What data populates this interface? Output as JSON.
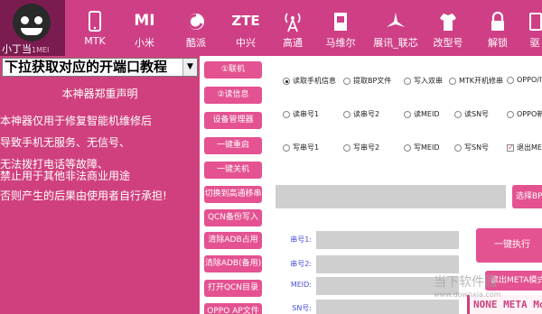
{
  "logo": {
    "text": "小丁当",
    "subtext": "1MEI"
  },
  "nav": [
    {
      "label": "MTK",
      "icon": "phone-icon"
    },
    {
      "label": "小米",
      "icon": "mi-icon"
    },
    {
      "label": "酷派",
      "icon": "coolpad-icon"
    },
    {
      "label": "中兴",
      "icon": "zte-icon"
    },
    {
      "label": "高通",
      "icon": "antenna-icon"
    },
    {
      "label": "马维尔",
      "icon": "chip-icon"
    },
    {
      "label": "展讯_联芯",
      "icon": "spreadtrum-icon"
    },
    {
      "label": "改型号",
      "icon": "shirt-icon"
    },
    {
      "label": "解锁",
      "icon": "lock-icon"
    },
    {
      "label": "驱",
      "icon": "driver-icon"
    }
  ],
  "nav_icon_text": {
    "mi": "MI",
    "zte": "ZTE"
  },
  "port_select": {
    "value": "下拉获取对应的开端口教程"
  },
  "declaration": {
    "title": "本神器郑重声明",
    "lines": [
      "本神器仅用于修复智能机维修后",
      "导致手机无服务、无信号、",
      "无法拨打电话等故障、",
      "禁止用于其他非法商业用途",
      "否则产生的后果由使用者自行承担!"
    ]
  },
  "mid_buttons": [
    "①联机",
    "②读信息",
    "设备管理器",
    "一键重启",
    "一键关机",
    "切换到高通移串",
    "QCN备份写入",
    "清除ADB占用",
    "清除ADB(备用)",
    "打开QCN目录",
    "OPPO AP文件"
  ],
  "radios": {
    "row1": [
      "读取手机信息",
      "提取BP文件",
      "写入双串",
      "MTK开机修串",
      "OPPO/IT"
    ],
    "row2": [
      "读串号1",
      "读串号2",
      "读MEID",
      "读SN号",
      "OPPO新款"
    ],
    "row3": [
      "写串号1",
      "写串号2",
      "写MEID",
      "写SN号"
    ],
    "checkbox": "退出META"
  },
  "select_bp_button": "选择BP文",
  "fields": {
    "imei1_label": "串号1:",
    "imei2_label": "串号2:",
    "meid_label": "MEID:",
    "sn_label": "SN号:"
  },
  "exec_button": "一键执行",
  "meta_button": "读出META模式",
  "meta_status": "NONE META Mo",
  "watermark": {
    "main": "当下软件园",
    "sub": "www.downxia.com"
  }
}
